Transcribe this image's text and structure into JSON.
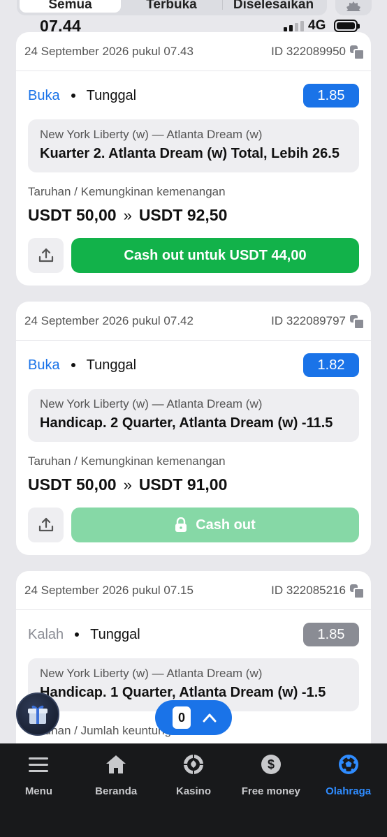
{
  "tabs": [
    {
      "label": "Semua",
      "active": true
    },
    {
      "label": "Terbuka",
      "active": false
    },
    {
      "label": "Diselesaikan",
      "active": false
    }
  ],
  "status_bar": {
    "time": "07.44",
    "network": "4G"
  },
  "cards": [
    {
      "date": "24 September 2026 pukul 07.43",
      "id": "ID 322089950",
      "status": "Buka",
      "type": "Tunggal",
      "odds": "1.85",
      "match": "New York Liberty (w) — Atlanta Dream (w)",
      "market": "Kuarter 2. Atlanta Dream (w) Total, Lebih 26.5",
      "stake_label": "Taruhan / Kemungkinan kemenangan",
      "stake": "USDT 50,00",
      "payout": "USDT 92,50",
      "cashout_label": "Cash out untuk USDT 44,00"
    },
    {
      "date": "24 September 2026 pukul 07.42",
      "id": "ID 322089797",
      "status": "Buka",
      "type": "Tunggal",
      "odds": "1.82",
      "match": "New York Liberty (w) — Atlanta Dream (w)",
      "market": "Handicap. 2 Quarter, Atlanta Dream (w) -11.5",
      "stake_label": "Taruhan / Kemungkinan kemenangan",
      "stake": "USDT 50,00",
      "payout": "USDT 91,00",
      "cashout_label": "Cash out"
    },
    {
      "date": "24 September 2026 pukul 07.15",
      "id": "ID 322085216",
      "status": "Kalah",
      "type": "Tunggal",
      "odds": "1.85",
      "match": "New York Liberty (w) — Atlanta Dream (w)",
      "market": "Handicap. 1 Quarter, Atlanta Dream (w) -1.5",
      "stake_label": "Taruhan / Jumlah keuntungan"
    }
  ],
  "bet_slip": {
    "count": "0"
  },
  "nav": [
    {
      "label": "Menu",
      "icon": "menu-icon"
    },
    {
      "label": "Beranda",
      "icon": "home-icon"
    },
    {
      "label": "Kasino",
      "icon": "casino-chip-icon"
    },
    {
      "label": "Free money",
      "icon": "dollar-coin-icon"
    },
    {
      "label": "Olahraga",
      "icon": "soccer-ball-icon",
      "active": true
    }
  ],
  "colors": {
    "accent": "#1a73e8",
    "cashout": "#12b24a",
    "cashout_disabled": "#86d8a6",
    "lost": "#8a8c94",
    "nav_bg": "#18191b"
  }
}
